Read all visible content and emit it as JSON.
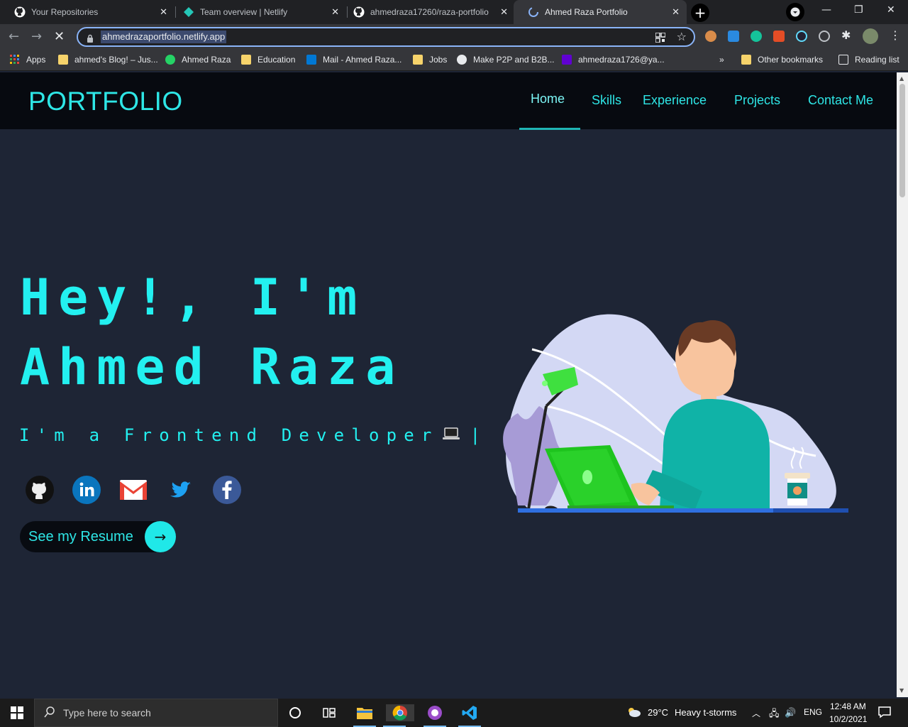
{
  "browser": {
    "tabs": [
      {
        "title": "Your Repositories",
        "icon": "github-icon"
      },
      {
        "title": "Team overview | Netlify",
        "icon": "netlify-icon"
      },
      {
        "title": "ahmedraza17260/raza-portfolio",
        "icon": "github-icon"
      },
      {
        "title": "Ahmed Raza Portfolio",
        "icon": "loading-icon",
        "active": true
      }
    ],
    "address": "ahmedrazaportfolio.netlify.app",
    "bookmarks": [
      {
        "label": "Apps",
        "icon": "apps-grid-icon"
      },
      {
        "label": "ahmed's Blog! – Jus...",
        "icon": "folder-icon"
      },
      {
        "label": "Ahmed Raza",
        "icon": "whatsapp-icon"
      },
      {
        "label": "Education",
        "icon": "folder-icon"
      },
      {
        "label": "Mail - Ahmed Raza...",
        "icon": "outlook-icon"
      },
      {
        "label": "Jobs",
        "icon": "folder-icon"
      },
      {
        "label": "Make P2P and B2B...",
        "icon": "globe-icon"
      },
      {
        "label": "ahmedraza1726@ya...",
        "icon": "yahoo-icon"
      }
    ],
    "overflow": "»",
    "other_bookmarks": "Other bookmarks",
    "reading_list": "Reading list"
  },
  "site": {
    "logo": "PORTFOLIO",
    "nav": [
      {
        "label": "Home",
        "active": true
      },
      {
        "label": "Skills"
      },
      {
        "label": "Experience"
      },
      {
        "label": "Projects"
      },
      {
        "label": "Contact Me"
      }
    ],
    "hero": {
      "line1": "Hey!, I'm",
      "line2": "Ahmed Raza",
      "subtitle": "I'm a Frontend Developer",
      "cursor": "|"
    },
    "socials": [
      "github-icon",
      "linkedin-icon",
      "gmail-icon",
      "twitter-icon",
      "facebook-icon"
    ],
    "resume_label": "See my Resume",
    "resume_arrow": "→",
    "accent": "#23f0f0"
  },
  "taskbar": {
    "search_placeholder": "Type here to search",
    "weather_temp": "29°C",
    "weather_desc": "Heavy t-storms",
    "language": "ENG",
    "time": "12:48 AM",
    "date": "10/2/2021"
  }
}
